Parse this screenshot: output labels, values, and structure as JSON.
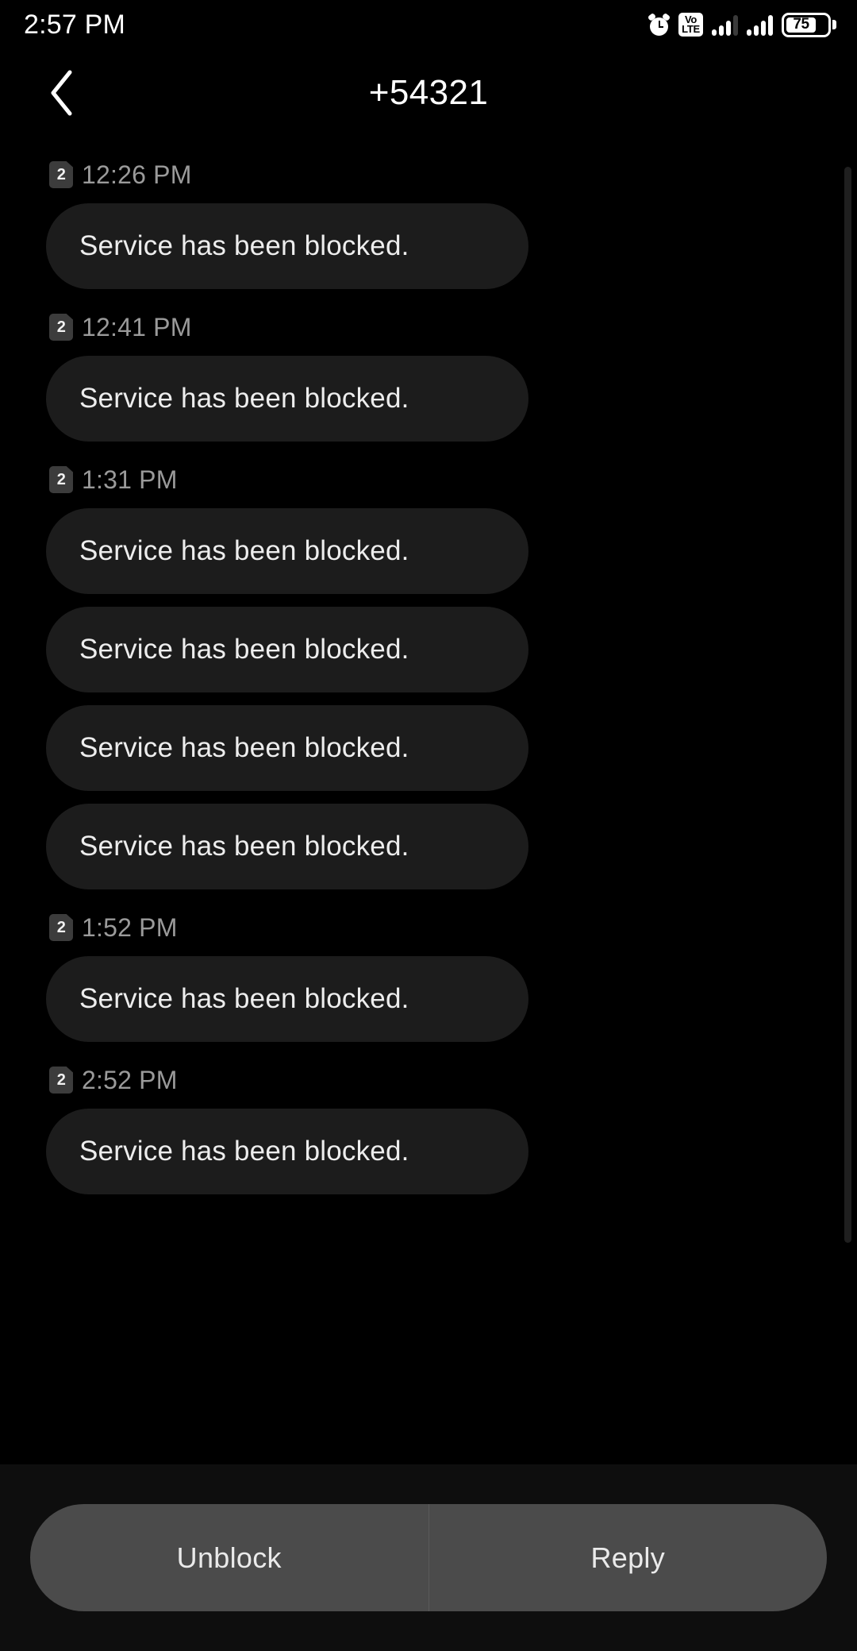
{
  "status_bar": {
    "time": "2:57 PM",
    "icons": [
      "alarm-icon",
      "volte-icon",
      "signal-sim1-icon",
      "signal-sim2-icon",
      "battery-icon"
    ],
    "volte_top": "Vo",
    "volte_bottom": "LTE",
    "battery_percent": "75"
  },
  "header": {
    "back_icon": "chevron-left-icon",
    "title": "+54321"
  },
  "conversation": {
    "message_text": "Service has been blocked.",
    "groups": [
      {
        "sim": "2",
        "time": "12:26 PM",
        "messages": [
          "Service has been blocked."
        ]
      },
      {
        "sim": "2",
        "time": "12:41 PM",
        "messages": [
          "Service has been blocked."
        ]
      },
      {
        "sim": "2",
        "time": "1:31 PM",
        "messages": [
          "Service has been blocked.",
          "Service has been blocked.",
          "Service has been blocked.",
          "Service has been blocked."
        ]
      },
      {
        "sim": "2",
        "time": "1:52 PM",
        "messages": [
          "Service has been blocked."
        ]
      },
      {
        "sim": "2",
        "time": "2:52 PM",
        "messages": [
          "Service has been blocked."
        ]
      }
    ]
  },
  "bottom_bar": {
    "unblock_label": "Unblock",
    "reply_label": "Reply"
  },
  "colors": {
    "background": "#000000",
    "bubble": "#1c1c1c",
    "bubble_text": "#ededed",
    "timestamp": "#9a9a9a",
    "sim_badge": "#3c3c3c",
    "action_pill": "#4b4b4b",
    "bottom_panel": "#0e0e0e",
    "scrollbar": "#1f1f1f"
  }
}
